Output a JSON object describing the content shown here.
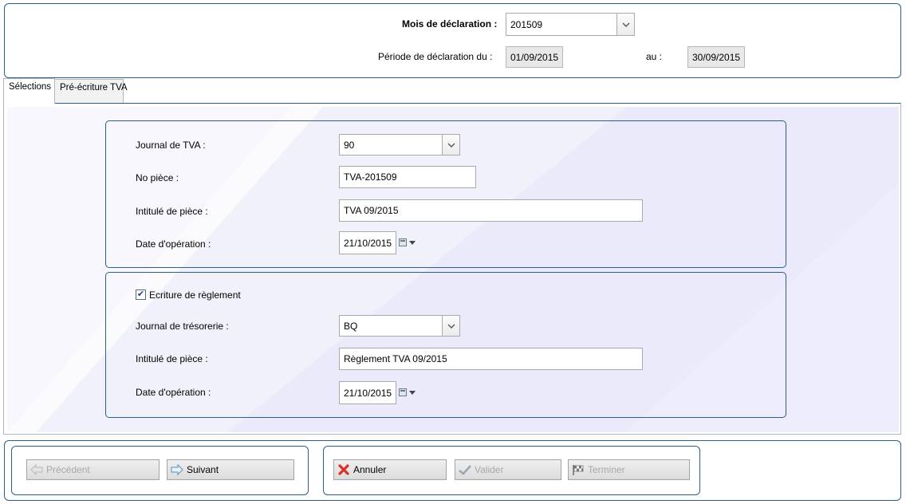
{
  "header": {
    "month_label": "Mois de déclaration :",
    "month_value": "201509",
    "period_label": "Période de déclaration du :",
    "period_from": "01/09/2015",
    "period_to_label": "au :",
    "period_to": "30/09/2015"
  },
  "tabs": [
    {
      "label": "Sélections",
      "active": true
    },
    {
      "label": "Pré-écriture TVA",
      "active": false
    }
  ],
  "section1": {
    "journal_label": "Journal de TVA :",
    "journal_value": "90",
    "piece_no_label": "No pièce :",
    "piece_no_value": "TVA-201509",
    "title_label": "Intitulé de pièce :",
    "title_value": "TVA 09/2015",
    "date_label": "Date d'opération :",
    "date_value": "21/10/2015"
  },
  "section2": {
    "checkbox_label": "Ecriture de règlement",
    "checkbox_checked": true,
    "journal_label": "Journal de trésorerie :",
    "journal_value": "BQ",
    "title_label": "Intitulé de pièce :",
    "title_value": "Règlement TVA 09/2015",
    "date_label": "Date d'opération :",
    "date_value": "21/10/2015"
  },
  "buttons": {
    "previous": "Précédent",
    "next": "Suivant",
    "cancel": "Annuler",
    "validate": "Valider",
    "finish": "Terminer"
  },
  "icons": {
    "combo_arrow": "chevron-down-icon",
    "calendar": "calendar-icon",
    "previous": "arrow-left-icon",
    "next": "arrow-right-icon",
    "cancel": "red-cross-icon",
    "validate": "checkmark-icon",
    "finish": "checkered-flag-icon"
  },
  "colors": {
    "frame_border": "#2b5f8a",
    "panel_tint": "#eeeefb",
    "cancel_icon": "#d9302c"
  }
}
